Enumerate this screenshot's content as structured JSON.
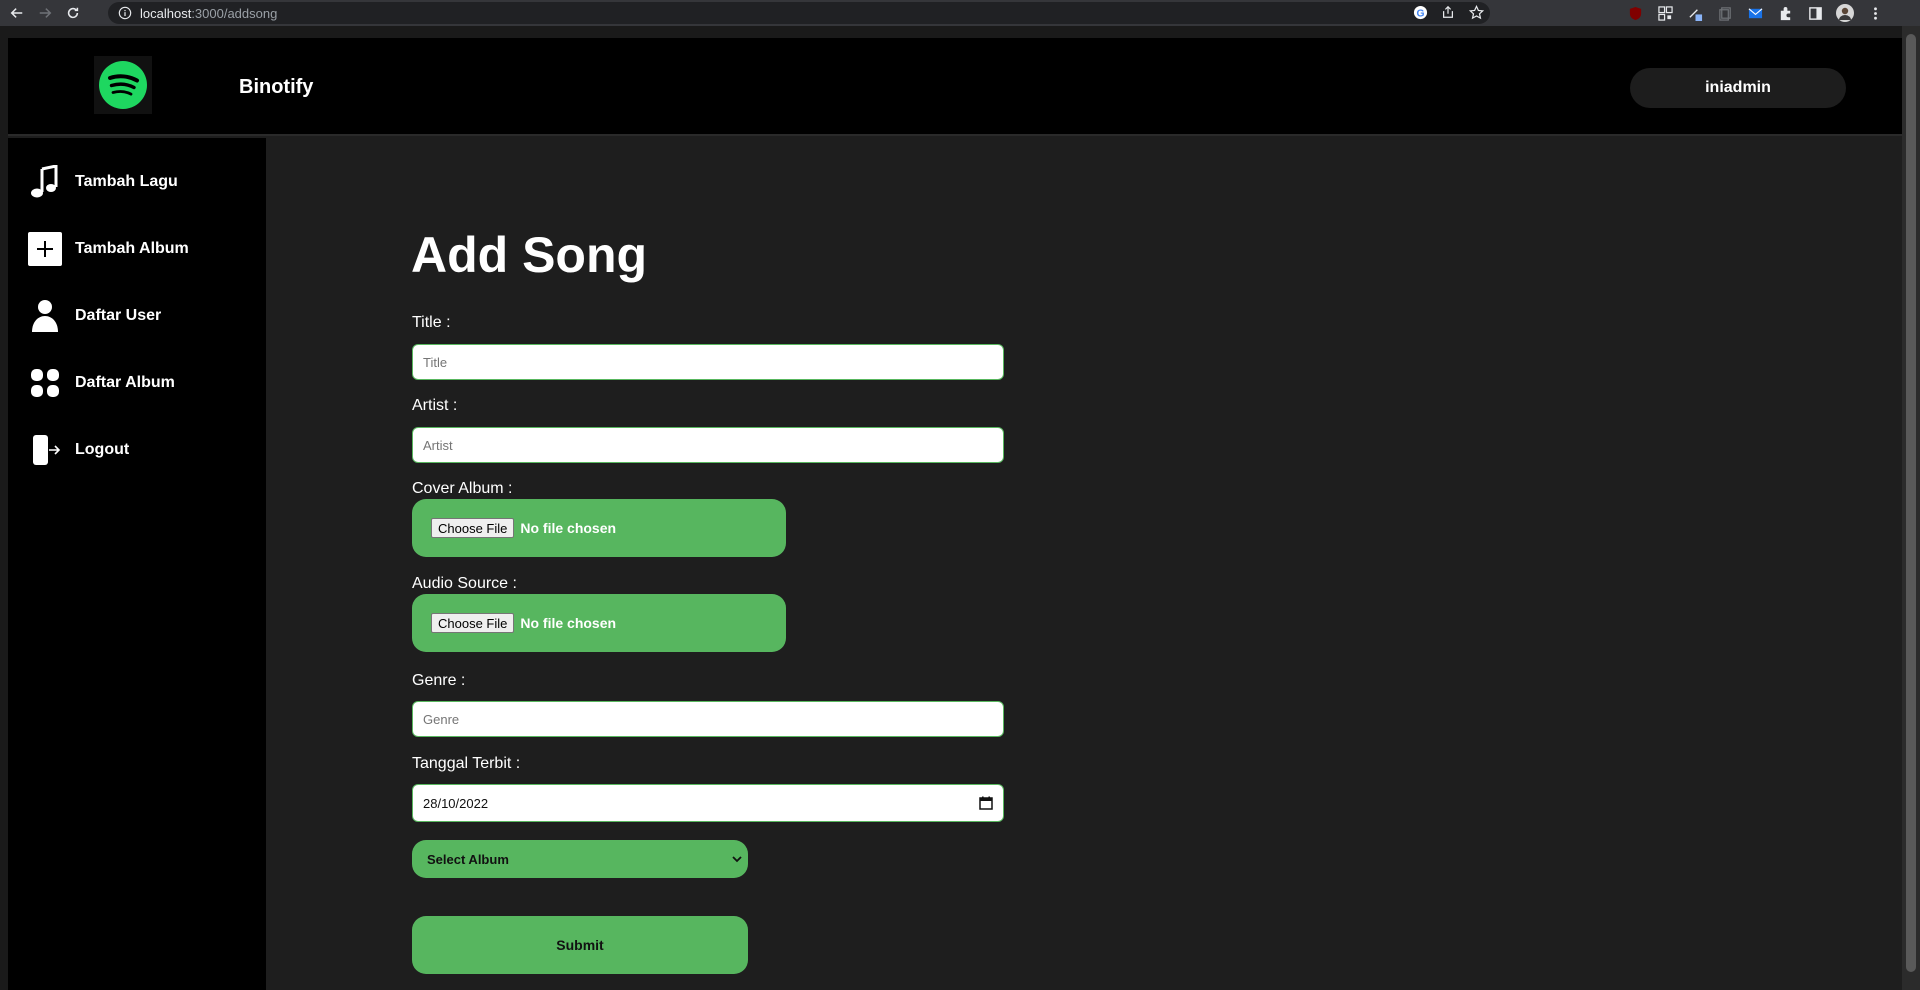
{
  "browser": {
    "url_host": "localhost",
    "url_path": ":3000/addsong"
  },
  "header": {
    "brand": "Binotify",
    "user": "iniadmin",
    "logo_icon": "spotify-logo-icon",
    "accent": "#1ed760"
  },
  "sidebar": {
    "items": [
      {
        "label": "Tambah Lagu",
        "icon": "music-note-icon"
      },
      {
        "label": "Tambah Album",
        "icon": "plus-square-icon"
      },
      {
        "label": "Daftar User",
        "icon": "user-icon"
      },
      {
        "label": "Daftar Album",
        "icon": "grid-icon"
      },
      {
        "label": "Logout",
        "icon": "logout-icon"
      }
    ]
  },
  "form": {
    "title": "Add Song",
    "title_label": "Title :",
    "title_placeholder": "Title",
    "artist_label": "Artist :",
    "artist_placeholder": "Artist",
    "cover_label": "Cover Album :",
    "cover_button": "Choose File",
    "cover_status": "No file chosen",
    "audio_label": "Audio Source :",
    "audio_button": "Choose File",
    "audio_status": "No file chosen",
    "genre_label": "Genre :",
    "genre_placeholder": "Genre",
    "date_label": "Tanggal Terbit :",
    "date_value": "28/10/2022",
    "album_select": "Select Album",
    "submit": "Submit",
    "accent": "#57b65f"
  }
}
